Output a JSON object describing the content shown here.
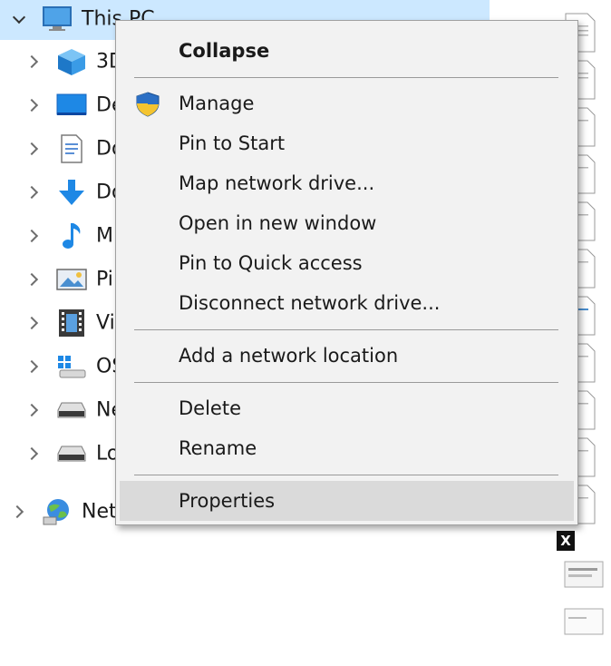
{
  "tree": {
    "this_pc": {
      "label": "This PC",
      "icon": "monitor-icon",
      "expanded": true
    },
    "children": [
      {
        "label": "3D",
        "icon": "3d-objects-icon"
      },
      {
        "label": "De",
        "icon": "desktop-icon"
      },
      {
        "label": "Do",
        "icon": "documents-icon"
      },
      {
        "label": "Do",
        "icon": "download-arrow-icon"
      },
      {
        "label": "M",
        "icon": "music-note-icon"
      },
      {
        "label": "Pi",
        "icon": "pictures-icon"
      },
      {
        "label": "Vi",
        "icon": "videos-icon"
      },
      {
        "label": "OS",
        "icon": "os-drive-icon"
      },
      {
        "label": "Ne",
        "icon": "drive-icon"
      },
      {
        "label": "Lo",
        "icon": "drive-icon"
      }
    ],
    "network": {
      "label": "Network",
      "icon": "network-globe-icon"
    }
  },
  "context_menu": {
    "collapse": "Collapse",
    "manage": "Manage",
    "manage_icon": "shield-icon",
    "pin_start": "Pin to Start",
    "map_drive": "Map network drive...",
    "open_new_window": "Open in new window",
    "pin_quick": "Pin to Quick access",
    "disconnect": "Disconnect network drive...",
    "add_location": "Add a network location",
    "delete": "Delete",
    "rename": "Rename",
    "properties": "Properties",
    "hovered_item": "Properties"
  },
  "file_column": {
    "badge": "X",
    "file_icon": "document-icon"
  },
  "colors": {
    "selection": "#cce8ff",
    "menu_bg": "#f2f2f2",
    "menu_hover": "#dadada",
    "icon_blue": "#1e88e5"
  }
}
